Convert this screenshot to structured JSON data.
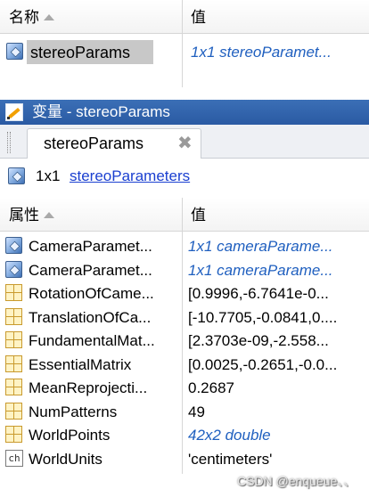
{
  "workspace": {
    "headers": {
      "name": "名称",
      "value": "值"
    },
    "row": {
      "name": "stereoParams",
      "value": "1x1 stereoParamet...",
      "icon": "struct-icon"
    }
  },
  "editor": {
    "title": "变量 - stereoParams",
    "tab": {
      "label": "stereoParams",
      "close": "✖"
    },
    "summary": {
      "dims": "1x1",
      "class": "stereoParameters"
    },
    "headers": {
      "property": "属性",
      "value": "值"
    },
    "properties": [
      {
        "name": "CameraParamet...",
        "value": "1x1 cameraParame...",
        "icon": "struct-icon",
        "link": true
      },
      {
        "name": "CameraParamet...",
        "value": "1x1 cameraParame...",
        "icon": "struct-icon",
        "link": true
      },
      {
        "name": "RotationOfCame...",
        "value": "[0.9996,-6.7641e-0...",
        "icon": "matrix-icon",
        "link": false
      },
      {
        "name": "TranslationOfCa...",
        "value": "[-10.7705,-0.0841,0....",
        "icon": "matrix-icon",
        "link": false
      },
      {
        "name": "FundamentalMat...",
        "value": "[2.3703e-09,-2.558...",
        "icon": "matrix-icon",
        "link": false
      },
      {
        "name": "EssentialMatrix",
        "value": "[0.0025,-0.2651,-0.0...",
        "icon": "matrix-icon",
        "link": false
      },
      {
        "name": "MeanReprojecti...",
        "value": "0.2687",
        "icon": "matrix-icon",
        "link": false
      },
      {
        "name": "NumPatterns",
        "value": "49",
        "icon": "matrix-icon",
        "link": false
      },
      {
        "name": "WorldPoints",
        "value": "42x2 double",
        "icon": "matrix-icon",
        "link": true
      },
      {
        "name": "WorldUnits",
        "value": "'centimeters'",
        "icon": "char-icon",
        "link": false
      }
    ],
    "char_icon_label": "ch"
  },
  "watermark": "CSDN @enqueue、、"
}
